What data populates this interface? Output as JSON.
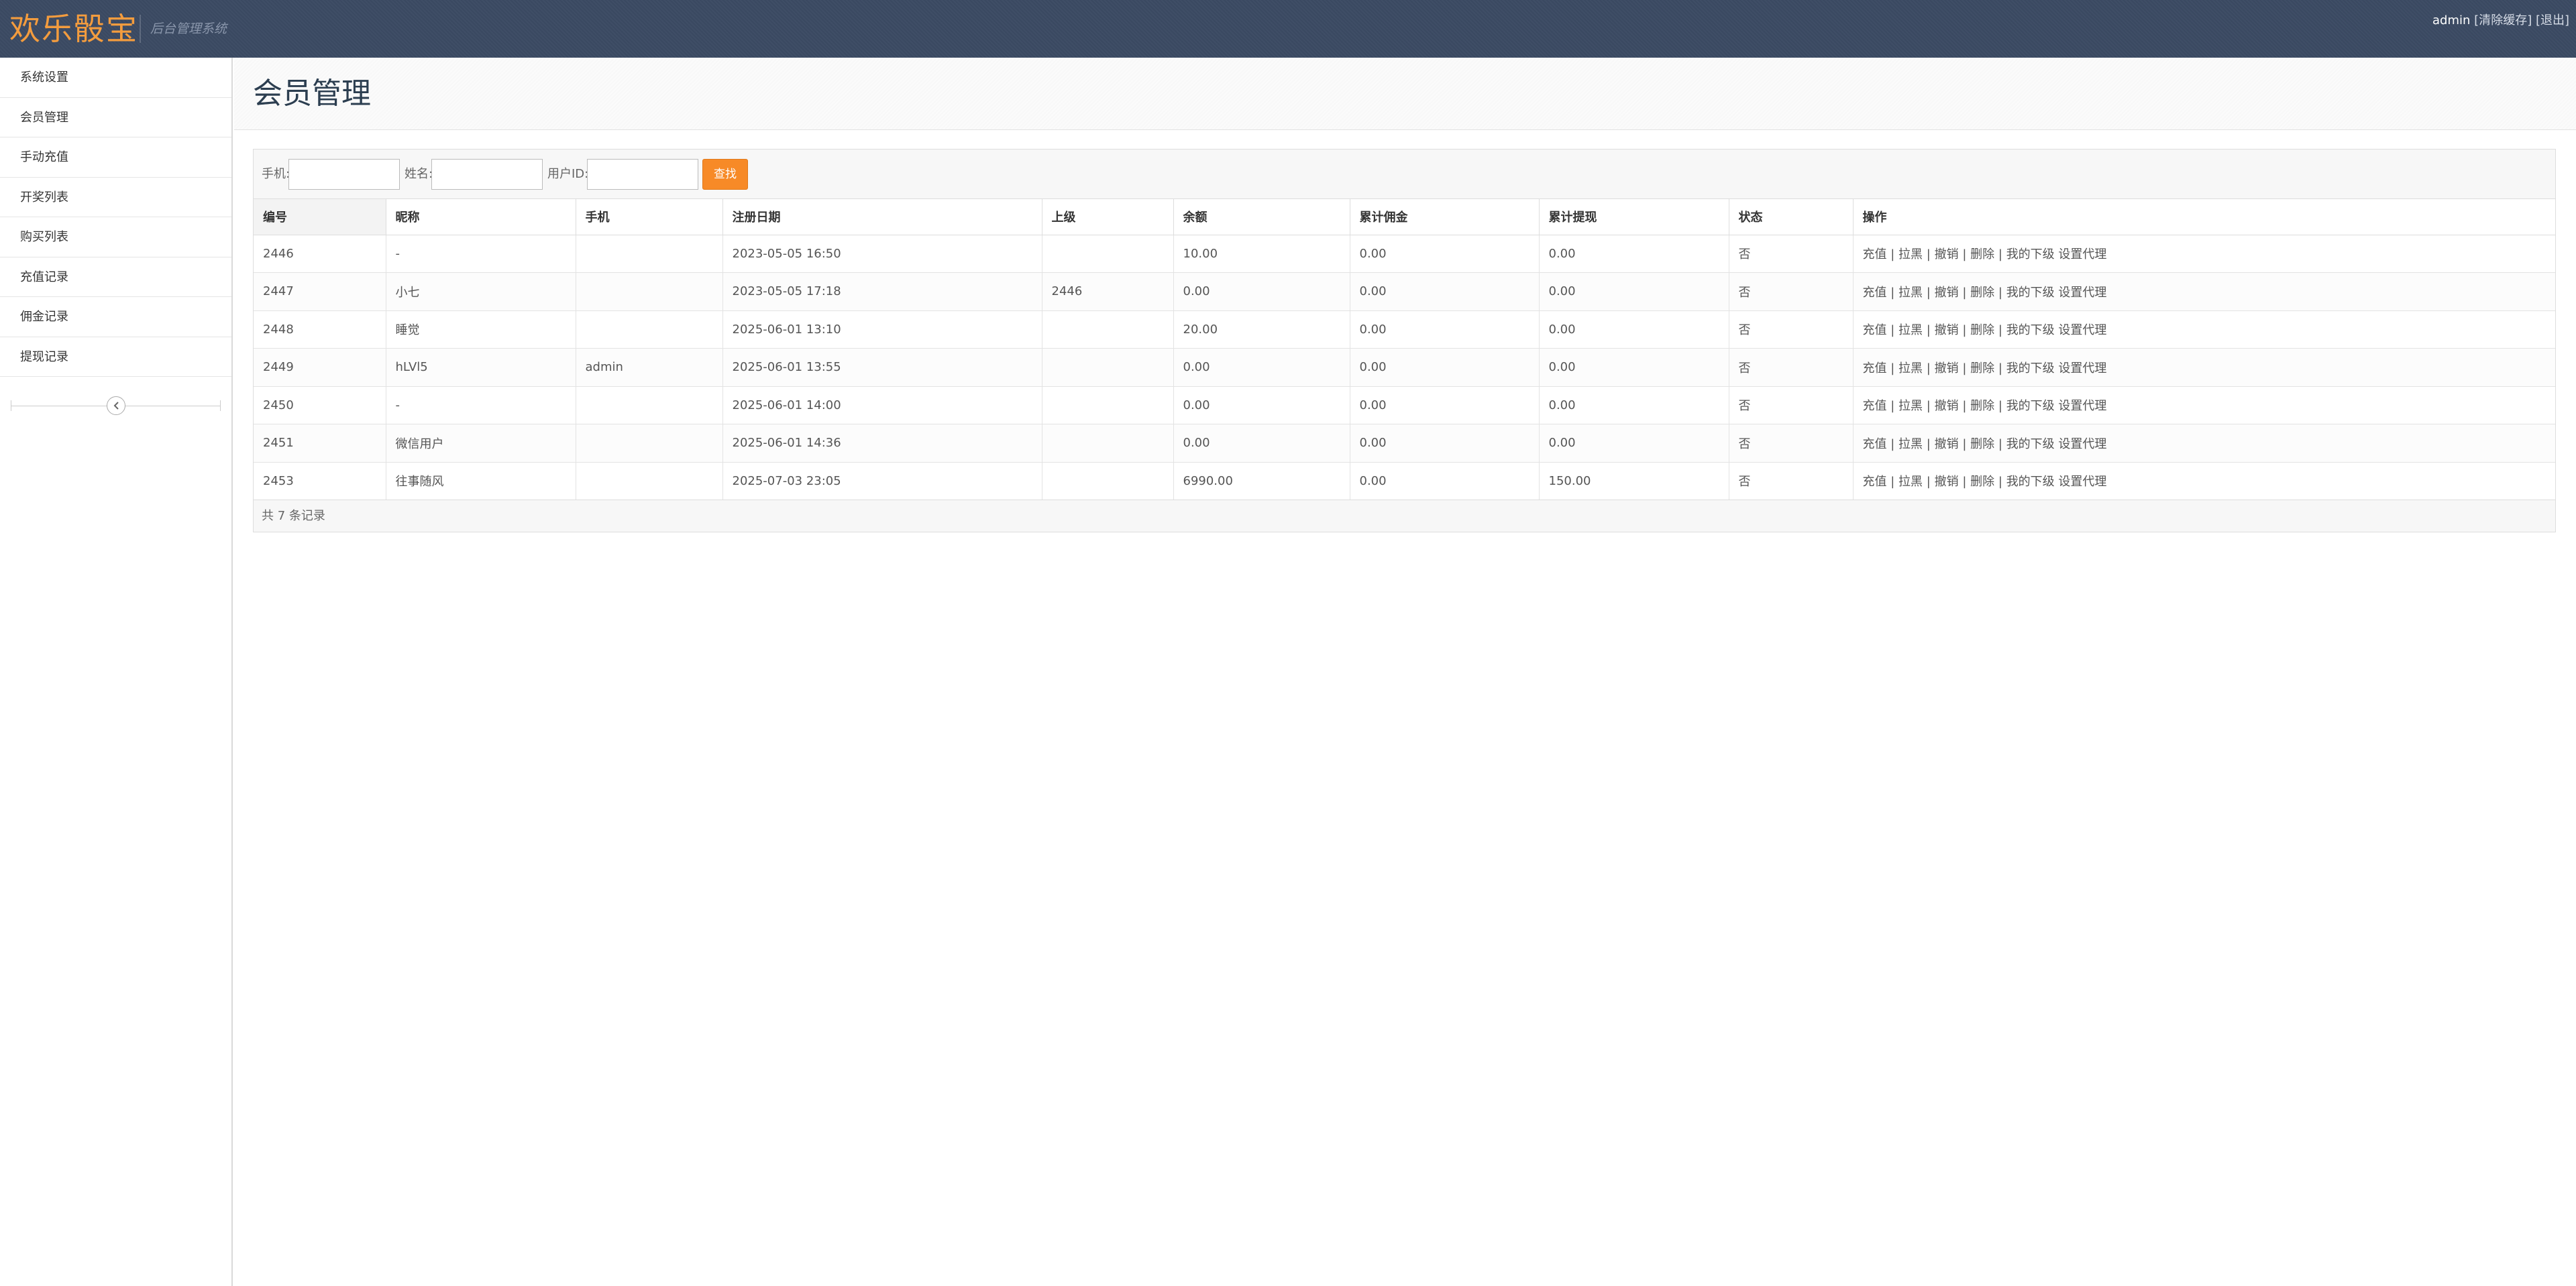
{
  "brand": {
    "title": "欢乐骰宝",
    "subtitle": "后台管理系统"
  },
  "user": {
    "name": "admin",
    "clear_cache": "[清除缓存]",
    "logout": "[退出]"
  },
  "sidebar": {
    "items": [
      {
        "label": "系统设置"
      },
      {
        "label": "会员管理"
      },
      {
        "label": "手动充值"
      },
      {
        "label": "开奖列表"
      },
      {
        "label": "购买列表"
      },
      {
        "label": "充值记录"
      },
      {
        "label": "佣金记录"
      },
      {
        "label": "提现记录"
      }
    ],
    "collapse_icon": "chevron-left-icon"
  },
  "page": {
    "title": "会员管理"
  },
  "search": {
    "phone_label": "手机:",
    "phone_value": "",
    "name_label": "姓名:",
    "name_value": "",
    "uid_label": "用户ID:",
    "uid_value": "",
    "button": "查找"
  },
  "table": {
    "columns": [
      "编号",
      "昵称",
      "手机",
      "注册日期",
      "上级",
      "余额",
      "累计佣金",
      "累计提现",
      "状态",
      "操作"
    ],
    "rows": [
      [
        "2446",
        "-",
        "",
        "2023-05-05 16:50",
        "",
        "10.00",
        "0.00",
        "0.00",
        "否"
      ],
      [
        "2447",
        "小七",
        "",
        "2023-05-05 17:18",
        "2446",
        "0.00",
        "0.00",
        "0.00",
        "否"
      ],
      [
        "2448",
        "睡觉",
        "",
        "2025-06-01 13:10",
        "",
        "20.00",
        "0.00",
        "0.00",
        "否"
      ],
      [
        "2449",
        "hLVl5",
        "admin",
        "2025-06-01 13:55",
        "",
        "0.00",
        "0.00",
        "0.00",
        "否"
      ],
      [
        "2450",
        "-",
        "",
        "2025-06-01 14:00",
        "",
        "0.00",
        "0.00",
        "0.00",
        "否"
      ],
      [
        "2451",
        "微信用户",
        "",
        "2025-06-01 14:36",
        "",
        "0.00",
        "0.00",
        "0.00",
        "否"
      ],
      [
        "2453",
        "往事随风",
        "",
        "2025-07-03 23:05",
        "",
        "6990.00",
        "0.00",
        "150.00",
        "否"
      ]
    ],
    "actions": {
      "recharge": "充值",
      "blacklist": "拉黑",
      "revoke": "撤销",
      "delete": "删除",
      "subordinates": "我的下级",
      "set_agent": "设置代理",
      "separator": "|"
    }
  },
  "footer": {
    "count_text": "共 7 条记录"
  },
  "colors": {
    "navbar": "#3b4a63",
    "brand": "#f39c3e",
    "search_button": "#f78a27"
  }
}
